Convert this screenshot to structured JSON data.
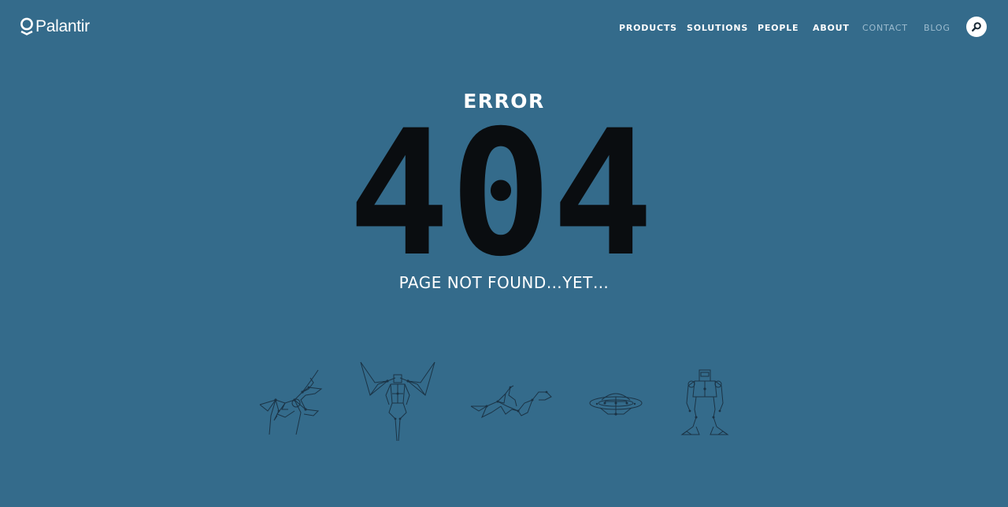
{
  "header": {
    "logo_text": "Palantir",
    "nav": [
      {
        "label": "PRODUCTS",
        "state": "normal"
      },
      {
        "label": "SOLUTIONS",
        "state": "normal"
      },
      {
        "label": "PEOPLE",
        "state": "normal"
      },
      {
        "label": "ABOUT",
        "state": "normal"
      },
      {
        "label": "CONTACT",
        "state": "muted"
      },
      {
        "label": "BLOG",
        "state": "muted"
      }
    ],
    "search_icon": "search-icon"
  },
  "main": {
    "error_label": "ERROR",
    "error_code": "404",
    "subtitle": "PAGE NOT FOUND…YET…"
  },
  "illustrations": [
    {
      "name": "deer-drawing"
    },
    {
      "name": "winged-figure-drawing"
    },
    {
      "name": "dragon-drawing"
    },
    {
      "name": "ufo-drawing"
    },
    {
      "name": "robot-drawing"
    }
  ],
  "colors": {
    "background": "#346b8b",
    "text": "#ffffff",
    "muted_nav": "#9dbccf",
    "error_code": "#0a0d10",
    "line_art": "#1b3345"
  }
}
